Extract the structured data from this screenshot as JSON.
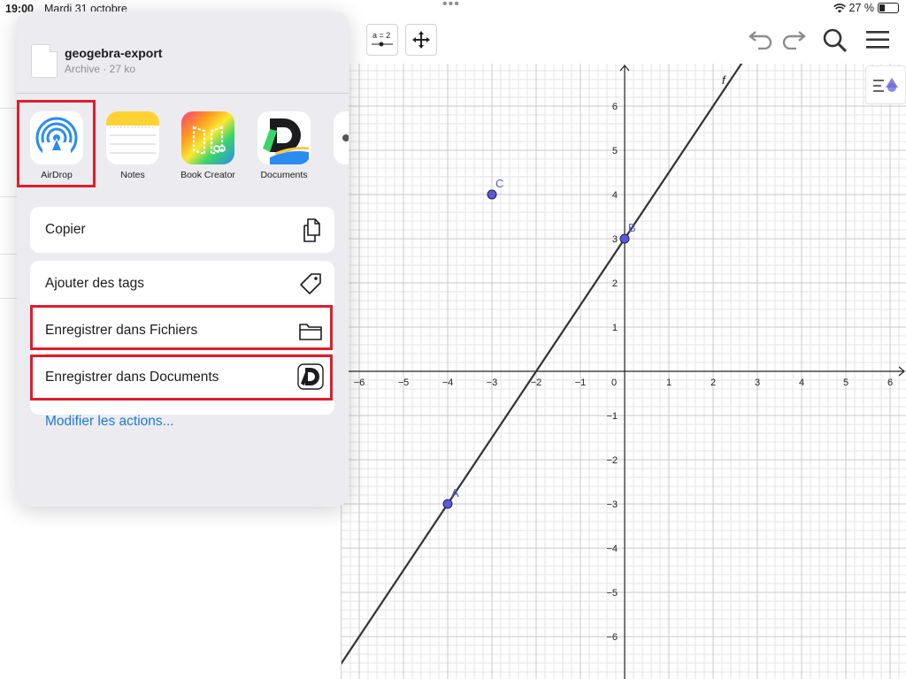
{
  "status_bar": {
    "time": "19:00",
    "date": "Mardi 31 octobre",
    "battery": "27 %",
    "battery_level": 0.27
  },
  "toolbar": {
    "slider_tool_label": "a = 2",
    "icons": [
      "wand-icon",
      "slider-icon",
      "move-view-icon",
      "undo-icon",
      "redo-icon",
      "search-icon",
      "menu-icon"
    ]
  },
  "share_sheet": {
    "file_name": "geogebra-export",
    "file_meta": "Archive · 27 ko",
    "apps": [
      {
        "label": "AirDrop",
        "icon": "airdrop-icon"
      },
      {
        "label": "Notes",
        "icon": "notes-icon"
      },
      {
        "label": "Book Creator",
        "icon": "book-creator-icon"
      },
      {
        "label": "Documents",
        "icon": "documents-icon"
      }
    ],
    "actions_group1": [
      {
        "label": "Copier",
        "icon": "copy-icon"
      }
    ],
    "actions_group2": [
      {
        "label": "Ajouter des tags",
        "icon": "tag-icon"
      },
      {
        "label": "Enregistrer dans Fichiers",
        "icon": "folder-icon"
      },
      {
        "label": "Enregistrer dans Documents",
        "icon": "documents-small-icon"
      }
    ],
    "modify_actions": "Modifier les actions..."
  },
  "graph": {
    "x_tick_labels": [
      "−6",
      "−5",
      "−4",
      "−3",
      "−2",
      "−1",
      "0",
      "1",
      "2",
      "3",
      "4",
      "5",
      "6"
    ],
    "y_tick_labels": [
      "6",
      "5",
      "4",
      "3",
      "2",
      "1",
      "−1",
      "−2",
      "−3",
      "−4",
      "−5",
      "−6"
    ],
    "line_label": "f",
    "points": [
      {
        "name": "A",
        "x": -4,
        "y": -3
      },
      {
        "name": "B",
        "x": 0,
        "y": 3
      },
      {
        "name": "C",
        "x": -3,
        "y": 4
      }
    ],
    "line_slope": 1.5,
    "line_intercept": 3,
    "colors": {
      "point": "#5b5bd6",
      "line": "#333333",
      "grid_major": "#c8c8c8",
      "grid_minor": "#e6e6e6",
      "highlight": "#e11d2b"
    }
  }
}
